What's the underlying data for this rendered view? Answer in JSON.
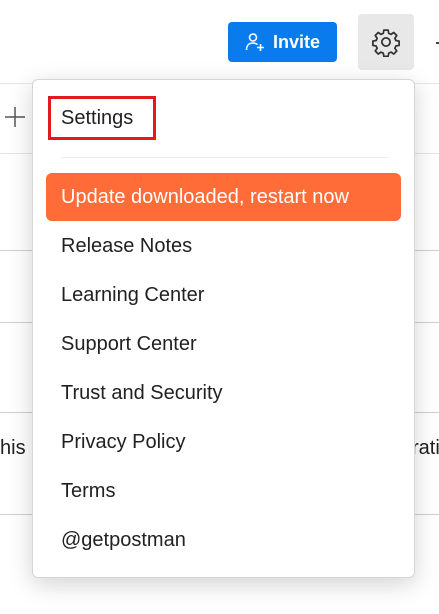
{
  "header": {
    "invite_label": "Invite"
  },
  "background": {
    "left_fragment": "his",
    "right_fragment": "rati"
  },
  "menu": {
    "items": [
      {
        "label": "Settings"
      },
      {
        "label": "Update downloaded, restart now"
      },
      {
        "label": "Release Notes"
      },
      {
        "label": "Learning Center"
      },
      {
        "label": "Support Center"
      },
      {
        "label": "Trust and Security"
      },
      {
        "label": "Privacy Policy"
      },
      {
        "label": "Terms"
      },
      {
        "label": "@getpostman"
      }
    ]
  },
  "colors": {
    "invite_button": "#097bed",
    "update_button": "#ff6c37",
    "highlight_box": "#e3191f"
  },
  "icons": {
    "invite": "add-user-icon",
    "settings": "gear-icon",
    "add": "plus-icon"
  }
}
